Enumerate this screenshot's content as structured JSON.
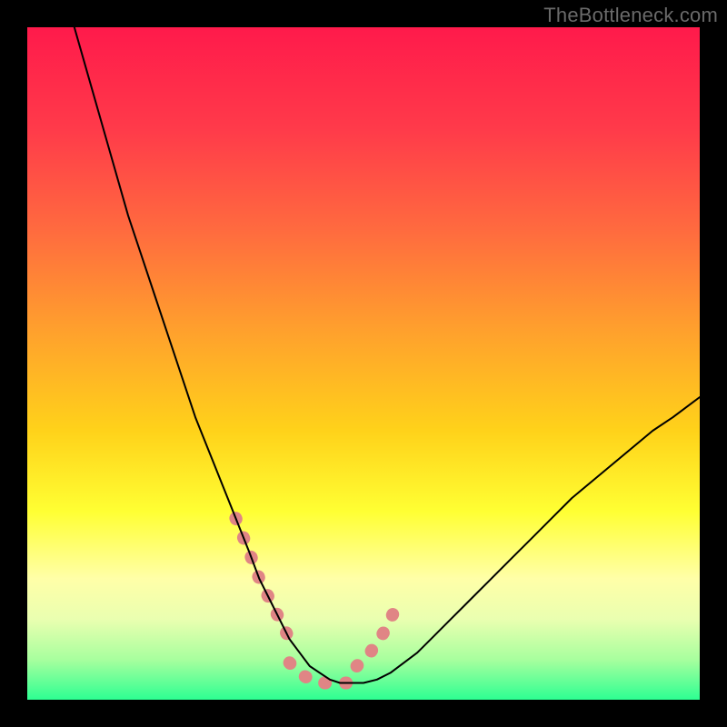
{
  "attribution": "TheBottleneck.com",
  "chart_data": {
    "type": "line",
    "title": "",
    "xlabel": "",
    "ylabel": "",
    "xlim": [
      0,
      100
    ],
    "ylim": [
      0,
      100
    ],
    "grid": false,
    "legend": false,
    "background_gradient_stops": [
      {
        "offset": 0.0,
        "color": "#ff1a4b"
      },
      {
        "offset": 0.15,
        "color": "#ff3a4a"
      },
      {
        "offset": 0.3,
        "color": "#ff6a3f"
      },
      {
        "offset": 0.45,
        "color": "#ffa02d"
      },
      {
        "offset": 0.6,
        "color": "#ffd21a"
      },
      {
        "offset": 0.72,
        "color": "#ffff33"
      },
      {
        "offset": 0.82,
        "color": "#ffffa8"
      },
      {
        "offset": 0.88,
        "color": "#eaffb0"
      },
      {
        "offset": 0.94,
        "color": "#a8ff9e"
      },
      {
        "offset": 1.0,
        "color": "#2dff92"
      }
    ],
    "series": [
      {
        "name": "bottleneck-curve",
        "color": "#000000",
        "width": 2,
        "x": [
          7,
          9,
          11,
          13,
          15,
          17,
          19,
          21,
          23,
          25,
          27,
          29,
          31,
          33,
          34.5,
          36,
          37.5,
          39,
          40.5,
          42,
          43.5,
          45,
          46.5,
          48,
          50,
          52,
          54,
          56,
          58,
          60,
          63,
          66,
          69,
          72,
          75,
          78,
          81,
          84,
          87,
          90,
          93,
          96,
          100
        ],
        "y": [
          100,
          93,
          86,
          79,
          72,
          66,
          60,
          54,
          48,
          42,
          37,
          32,
          27,
          22,
          18,
          15,
          12,
          9,
          7,
          5,
          4,
          3,
          2.5,
          2.5,
          2.5,
          3,
          4,
          5.5,
          7,
          9,
          12,
          15,
          18,
          21,
          24,
          27,
          30,
          32.5,
          35,
          37.5,
          40,
          42,
          45
        ]
      }
    ],
    "highlight_segments": [
      {
        "name": "pink-left-descender",
        "color": "#e08585",
        "width": 14,
        "x": [
          31,
          33,
          34.5,
          36,
          37.5,
          39
        ],
        "y": [
          27,
          22,
          18,
          15,
          12,
          9
        ]
      },
      {
        "name": "pink-trough",
        "color": "#e08585",
        "width": 14,
        "x": [
          39,
          40.5,
          42,
          43.5,
          45,
          46.5,
          48
        ],
        "y": [
          5.5,
          4,
          3,
          2.5,
          2.5,
          2.5,
          2.5
        ]
      },
      {
        "name": "pink-right-ascender",
        "color": "#e08585",
        "width": 14,
        "x": [
          49,
          51,
          53,
          55
        ],
        "y": [
          5,
          7,
          10,
          14
        ]
      }
    ]
  }
}
